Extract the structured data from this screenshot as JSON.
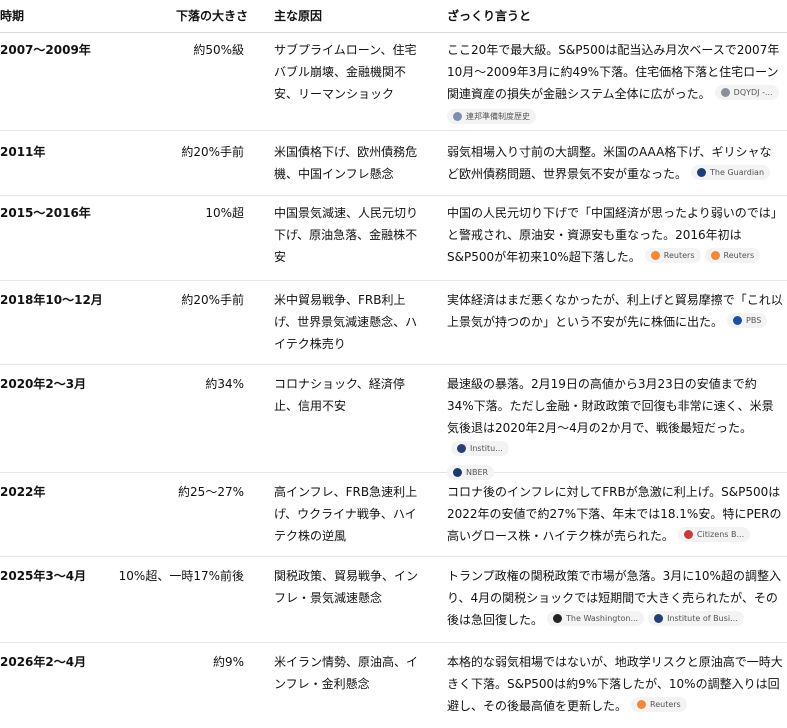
{
  "headers": {
    "period": "時期",
    "drop": "下落の大きさ",
    "cause": "主な原因",
    "summary": "ざっくり言うと"
  },
  "rows": [
    {
      "period": "2007〜2009年",
      "drop": "約50%級",
      "cause": "サブプライムローン、住宅バブル崩壊、金融機関不安、リーマンショック",
      "summary": "ここ20年で最大級。S&P500は配当込み月次ベースで2007年10月〜2009年3月に約49%下落。住宅価格下落と住宅ローン関連資産の損失が金融システム全体に広がった。",
      "sources": [
        "DQYDJ -...",
        "連邦準備制度歴史"
      ]
    },
    {
      "period": "2011年",
      "drop": "約20%手前",
      "cause": "米国債格下げ、欧州債務危機、中国インフレ懸念",
      "summary": "弱気相場入り寸前の大調整。米国のAAA格下げ、ギリシャなど欧州債務問題、世界景気不安が重なった。",
      "sources": [
        "The Guardian"
      ]
    },
    {
      "period": "2015〜2016年",
      "drop": "10%超",
      "cause": "中国景気減速、人民元切り下げ、原油急落、金融株不安",
      "summary": "中国の人民元切り下げで「中国経済が思ったより弱いのでは」と警戒され、原油安・資源安も重なった。2016年初はS&P500が年初来10%超下落した。",
      "sources": [
        "Reuters",
        "Reuters"
      ]
    },
    {
      "period": "2018年10〜12月",
      "drop": "約20%手前",
      "cause": "米中貿易戦争、FRB利上げ、世界景気減速懸念、ハイテク株売り",
      "summary": "実体経済はまだ悪くなかったが、利上げと貿易摩擦で「これ以上景気が持つのか」という不安が先に株価に出た。",
      "sources": [
        "PBS"
      ]
    },
    {
      "period": "2020年2〜3月",
      "drop": "約34%",
      "cause": "コロナショック、経済停止、信用不安",
      "summary": "最速級の暴落。2月19日の高値から3月23日の安値まで約34%下落。ただし金融・財政政策で回復も非常に速く、米景気後退は2020年2月〜4月の2か月で、戦後最短だった。",
      "sources": [
        "Institu...",
        "NBER"
      ]
    },
    {
      "period": "2022年",
      "drop": "約25〜27%",
      "cause": "高インフレ、FRB急速利上げ、ウクライナ戦争、ハイテク株の逆風",
      "summary": "コロナ後のインフレに対してFRBが急激に利上げ。S&P500は2022年の安値で約27%下落、年末では18.1%安。特にPERの高いグロース株・ハイテク株が売られた。",
      "sources": [
        "Citizens B..."
      ]
    },
    {
      "period": "2025年3〜4月",
      "drop": "10%超、一時17%前後",
      "cause": "関税政策、貿易戦争、インフレ・景気減速懸念",
      "summary": "トランプ政権の関税政策で市場が急落。3月に10%超の調整入り、4月の関税ショックでは短期間で大きく売られたが、その後は急回復した。",
      "sources": [
        "The Washington...",
        "Institute of Busi..."
      ]
    },
    {
      "period": "2026年2〜4月",
      "drop": "約9%",
      "cause": "米イラン情勢、原油高、インフレ・金利懸念",
      "summary": "本格的な弱気相場ではないが、地政学リスクと原油高で一時大きく下落。S&P500は約9%下落したが、10%の調整入りは回避し、その後最高値を更新した。",
      "sources": [
        "Reuters"
      ]
    }
  ],
  "colors": {
    "source_chip_bg": "#f3f3f3",
    "dqydj": "#8a8f99",
    "fed": "#7c8fb0",
    "guardian": "#1c3f78",
    "reuters": "#f08a3a",
    "pbs": "#1f4fa3",
    "institu": "#2a3f73",
    "nber": "#1b3b6f",
    "citizens": "#c63b3b",
    "washington": "#222222",
    "institute_busi": "#23406e"
  }
}
